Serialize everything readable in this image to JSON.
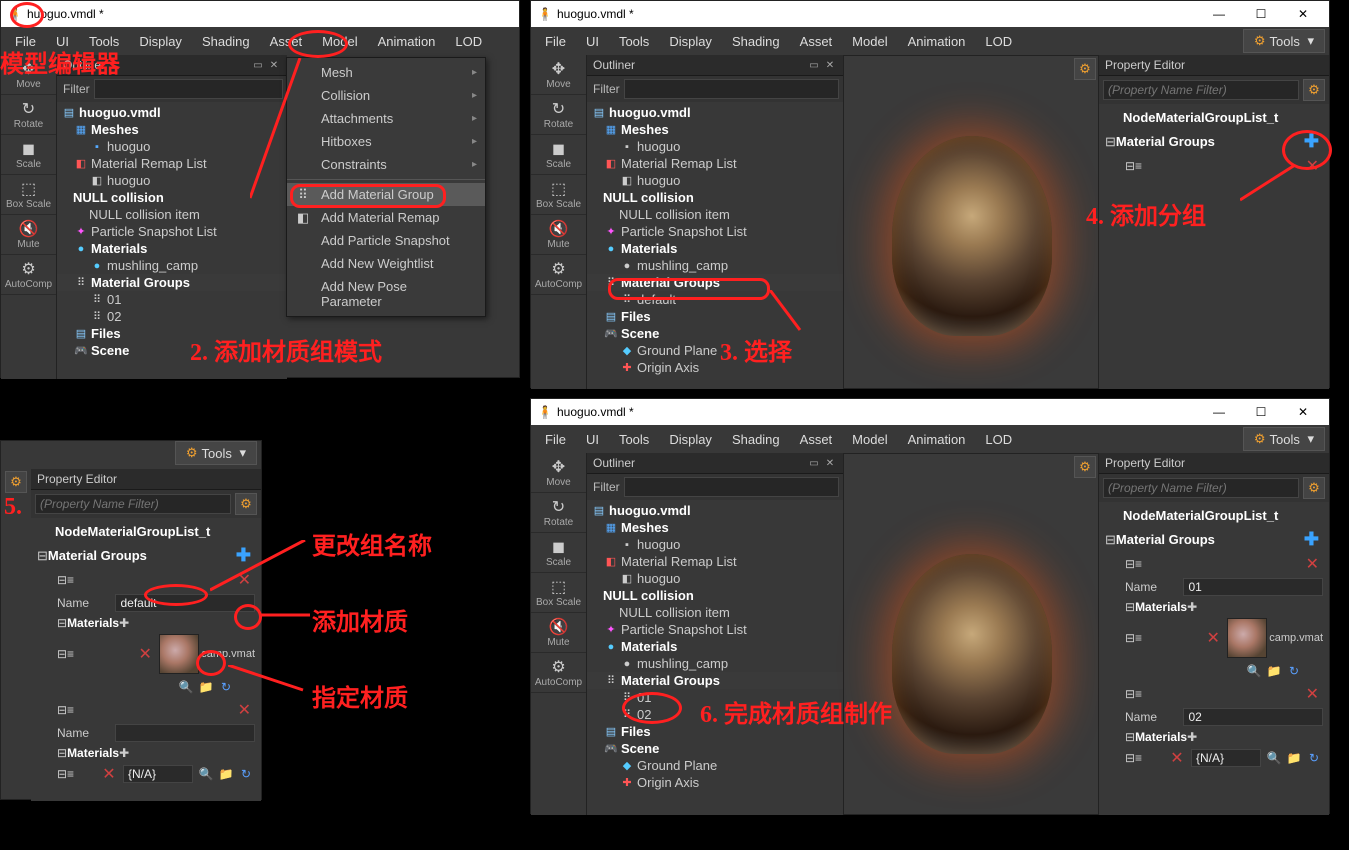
{
  "title": "huoguo.vmdl *",
  "menus": [
    "File",
    "UI",
    "Tools",
    "Display",
    "Shading",
    "Asset",
    "Model",
    "Animation",
    "LOD"
  ],
  "tools_btn": "Tools",
  "side": {
    "move": "Move",
    "rotate": "Rotate",
    "scale": "Scale",
    "boxscale": "Box Scale",
    "mute": "Mute",
    "autocomp": "AutoComp"
  },
  "outliner": {
    "title": "Outliner",
    "filter": "Filter",
    "file": "huoguo.vmdl",
    "meshes": "Meshes",
    "huoguo": "huoguo",
    "remap": "Material Remap List",
    "nullcol": "NULL collision",
    "nullitem": "NULL collision item",
    "psnap": "Particle Snapshot List",
    "materials": "Materials",
    "mushling": "mushling_camp",
    "matgroups": "Material Groups",
    "mg01": "01",
    "mg02": "02",
    "default": "default",
    "files": "Files",
    "scene": "Scene",
    "ground": "Ground Plane",
    "origin": "Origin Axis"
  },
  "dropdown": {
    "mesh": "Mesh",
    "collision": "Collision",
    "attachments": "Attachments",
    "hitboxes": "Hitboxes",
    "constraints": "Constraints",
    "addmg": "Add Material Group",
    "addmr": "Add Material Remap",
    "addps": "Add Particle Snapshot",
    "addwl": "Add New Weightlist",
    "addpp": "Add New Pose Parameter"
  },
  "prop": {
    "title": "Property Editor",
    "filter_ph": "(Property Name Filter)",
    "node": "NodeMaterialGroupList_t",
    "groups": "Material Groups",
    "name": "Name",
    "materials": "Materials",
    "default": "default",
    "campvmat": "camp.vmat",
    "na": "{N/A}",
    "v01": "01",
    "v02": "02"
  },
  "annot": {
    "a1": "模型编辑器",
    "a2": "2. 添加材质组模式",
    "a3": "3. 选择",
    "a4": "4. 添加分组",
    "a5": "5.",
    "a5b": "更改组名称",
    "a5c": "添加材质",
    "a5d": "指定材质",
    "a6": "6. 完成材质组制作"
  }
}
